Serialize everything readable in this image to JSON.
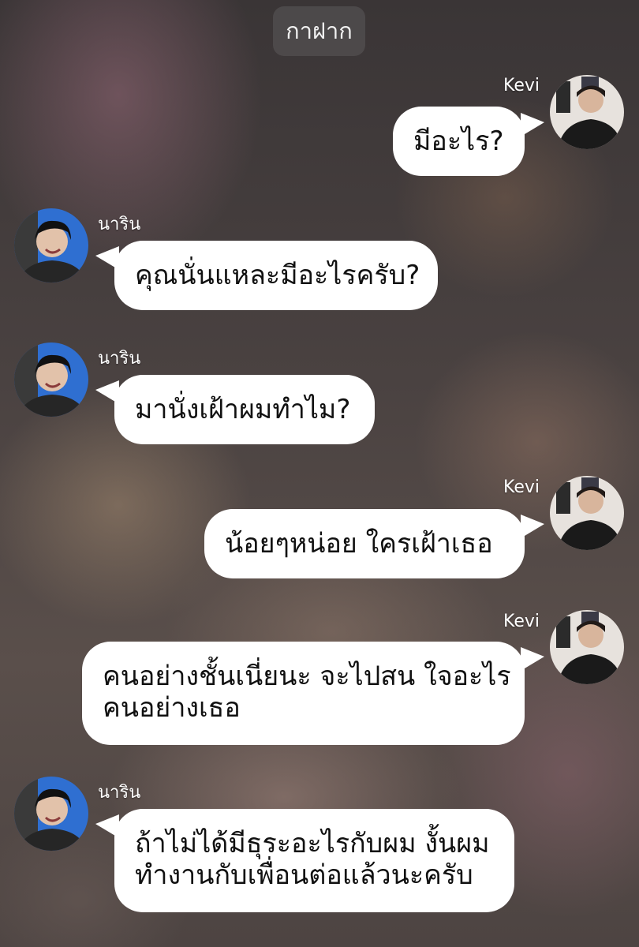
{
  "header": {
    "title": "กาฝาก"
  },
  "messages": [
    {
      "sender": "Kevi",
      "side": "right",
      "lines": [
        "มีอะไร?"
      ]
    },
    {
      "sender": "นาริน",
      "side": "left",
      "lines": [
        "คุณนั่นแหละมีอะไรครับ?"
      ]
    },
    {
      "sender": "นาริน",
      "side": "left",
      "lines": [
        "มานั่งเฝ้าผมทำไม?"
      ]
    },
    {
      "sender": "Kevi",
      "side": "right",
      "lines": [
        "น้อยๆหน่อย ใครเฝ้าเธอ"
      ]
    },
    {
      "sender": "Kevi",
      "side": "right",
      "lines": [
        "คนอย่างชั้นเนี่ยนะ จะไปสน ใจอะไร",
        "คนอย่างเธอ"
      ]
    },
    {
      "sender": "นาริน",
      "side": "left",
      "lines": [
        "ถ้าไม่ได้มีธุระอะไรกับผม งั้นผม",
        "ทำงานกับเพื่อนต่อแล้วนะครับ"
      ]
    }
  ]
}
